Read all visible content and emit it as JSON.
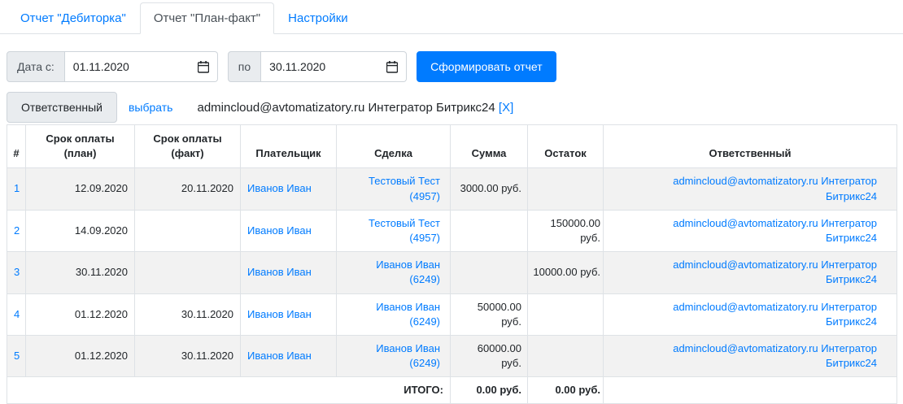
{
  "tabs": [
    {
      "label": "Отчет \"Дебиторка\"",
      "active": false
    },
    {
      "label": "Отчет \"План-факт\"",
      "active": true
    },
    {
      "label": "Настройки",
      "active": false
    }
  ],
  "filters": {
    "date_from_label": "Дата с:",
    "date_from_value": "01.11.2020",
    "date_to_label": "по",
    "date_to_value": "30.11.2020",
    "generate_button": "Сформировать отчет",
    "responsible_label": "Ответственный",
    "choose_link": "выбрать",
    "responsible_selected": "admincloud@avtomatizatory.ru Интегратор Битрикс24",
    "responsible_remove": "[X]"
  },
  "table": {
    "headers": [
      "#",
      "Срок оплаты (план)",
      "Срок оплаты (факт)",
      "Плательщик",
      "Сделка",
      "Сумма",
      "Остаток",
      "Ответственный"
    ],
    "rows": [
      {
        "num": "1",
        "plan": "12.09.2020",
        "fact": "20.11.2020",
        "payer": "Иванов Иван",
        "deal": "Тестовый Тест (4957)",
        "sum": "3000.00 руб.",
        "rest": "",
        "responsible": "admincloud@avtomatizatory.ru Интегратор Битрикс24"
      },
      {
        "num": "2",
        "plan": "14.09.2020",
        "fact": "",
        "payer": "Иванов Иван",
        "deal": "Тестовый Тест (4957)",
        "sum": "",
        "rest": "150000.00 руб.",
        "responsible": "admincloud@avtomatizatory.ru Интегратор Битрикс24"
      },
      {
        "num": "3",
        "plan": "30.11.2020",
        "fact": "",
        "payer": "Иванов Иван",
        "deal": "Иванов Иван (6249)",
        "sum": "",
        "rest": "10000.00 руб.",
        "responsible": "admincloud@avtomatizatory.ru Интегратор Битрикс24"
      },
      {
        "num": "4",
        "plan": "01.12.2020",
        "fact": "30.11.2020",
        "payer": "Иванов Иван",
        "deal": "Иванов Иван (6249)",
        "sum": "50000.00 руб.",
        "rest": "",
        "responsible": "admincloud@avtomatizatory.ru Интегратор Битрикс24"
      },
      {
        "num": "5",
        "plan": "01.12.2020",
        "fact": "30.11.2020",
        "payer": "Иванов Иван",
        "deal": "Иванов Иван (6249)",
        "sum": "60000.00 руб.",
        "rest": "",
        "responsible": "admincloud@avtomatizatory.ru Интегратор Битрикс24"
      }
    ],
    "footer": {
      "total_label": "ИТОГО:",
      "total_sum": "0.00 руб.",
      "total_rest": "0.00 руб."
    }
  },
  "colors": {
    "accent": "#007bff",
    "link": "#007bff",
    "border": "#dee2e6",
    "stripe": "#f2f2f2",
    "input_label_bg": "#e9ecef"
  },
  "icons": {
    "calendar": "calendar-icon"
  }
}
